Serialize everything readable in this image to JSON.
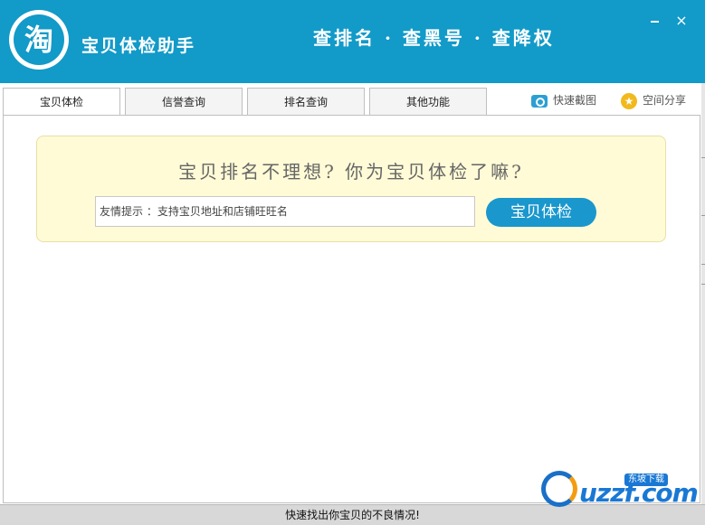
{
  "header": {
    "logo_char": "淘",
    "app_title": "宝贝体检助手",
    "slogan": "查排名 · 查黑号 · 查降权",
    "minimize_label": "",
    "close_label": "×"
  },
  "tabs": [
    {
      "label": "宝贝体检",
      "active": true
    },
    {
      "label": "信誉查询",
      "active": false
    },
    {
      "label": "排名查询",
      "active": false
    },
    {
      "label": "其他功能",
      "active": false
    }
  ],
  "tools": {
    "screenshot_label": "快速截图",
    "screenshot_icon": "camera-icon",
    "share_label": "空间分享",
    "share_icon": "star-icon"
  },
  "promo": {
    "headline": "宝贝排名不理想? 你为宝贝体检了嘛?",
    "input_placeholder": "友情提示 ：支持宝贝地址和店铺旺旺名",
    "button_label": "宝贝体检"
  },
  "status": {
    "text": "快速找出你宝贝的不良情况!"
  },
  "watermark": {
    "text": "uzzf.com",
    "badge": "东坡下载"
  },
  "colors": {
    "header_bg": "#129ac8",
    "button_bg": "#1a97cd",
    "promo_bg": "#fffbd6",
    "star": "#f1b91c"
  }
}
